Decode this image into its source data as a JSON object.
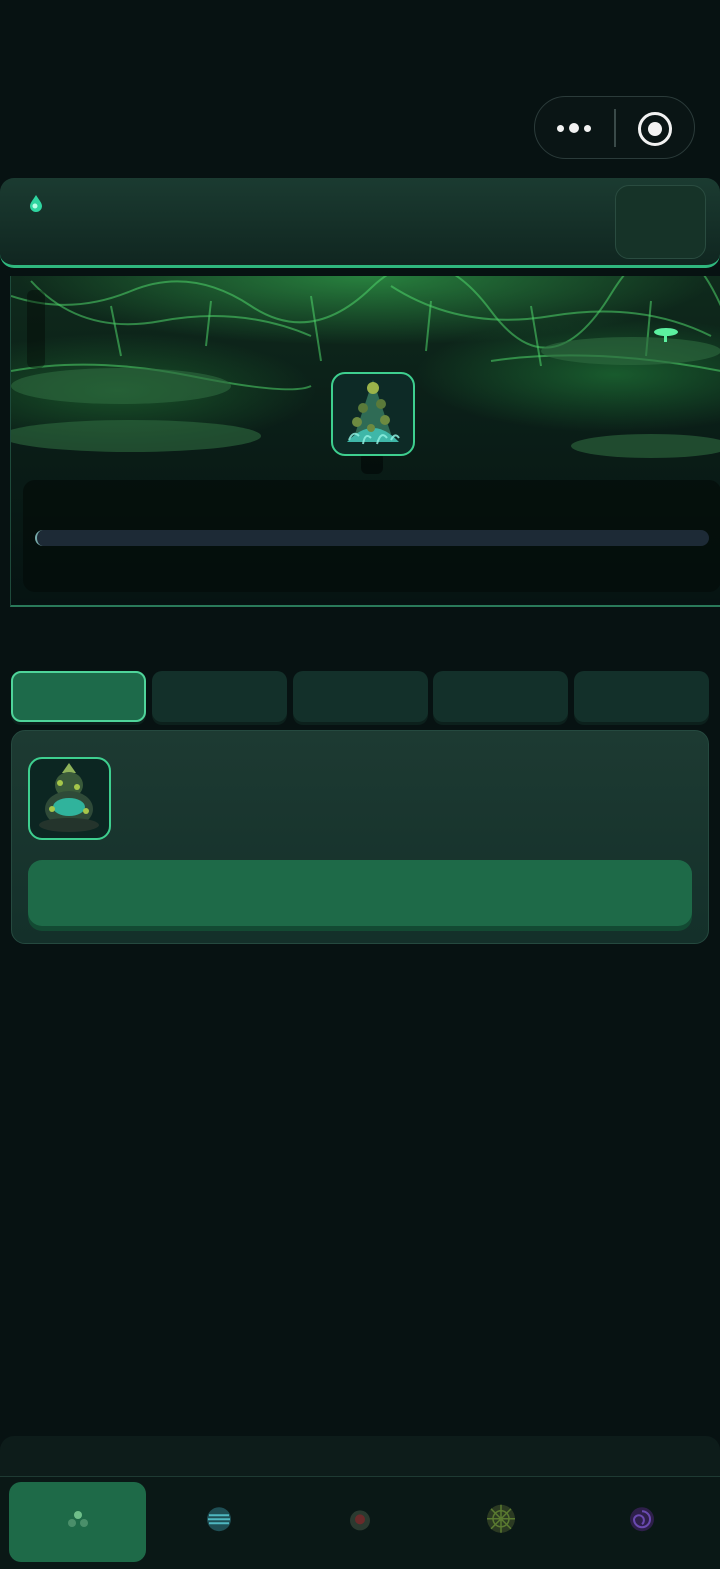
{
  "status_capsule": {
    "more_icon": "more-dots-icon",
    "target_icon": "record-target-icon"
  },
  "header": {
    "resource_icon": "green-droplet-icon"
  },
  "scene": {
    "boss_icon": "fungal-mound-creature-icon",
    "hp_fraction": 0.0
  },
  "tabs": [
    {
      "id": "tab-1",
      "active": true
    },
    {
      "id": "tab-2",
      "active": false
    },
    {
      "id": "tab-3",
      "active": false
    },
    {
      "id": "tab-4",
      "active": false
    },
    {
      "id": "tab-5",
      "active": false
    }
  ],
  "item": {
    "icon": "glowing-spore-creature-icon"
  },
  "bottom_nav": [
    {
      "icon": "mushroom-cluster-icon",
      "active": true
    },
    {
      "icon": "spore-orb-icon",
      "active": false
    },
    {
      "icon": "red-bulb-icon",
      "active": false
    },
    {
      "icon": "web-ball-icon",
      "active": false
    },
    {
      "icon": "purple-vortex-icon",
      "active": false
    }
  ],
  "colors": {
    "background": "#071212",
    "accent": "#3ecf8f",
    "active_tab": "#1d6a4a",
    "action_button": "#1e6a48"
  }
}
